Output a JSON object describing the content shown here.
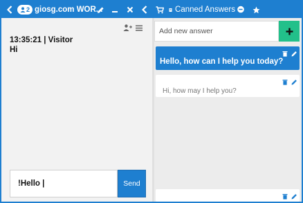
{
  "header": {
    "visitor_count": "2",
    "site_title": "giosg.com WOR...",
    "canned_title": "Canned Answers"
  },
  "chat": {
    "message_meta": "13:35:21 | Visitor",
    "message_text": "Hi",
    "composer_value": "!Hello |",
    "send_label": "Send"
  },
  "canned": {
    "placeholder": "Add new answer",
    "answers": [
      {
        "text": "Hello, how can I help you today?",
        "selected": true
      },
      {
        "text": "Hi, how may I help you?",
        "selected": false
      },
      {
        "text": "",
        "selected": false
      }
    ]
  },
  "colors": {
    "accent": "#1e7fd0",
    "add_button": "#22c08a",
    "action_icon": "#1e7fd0"
  }
}
